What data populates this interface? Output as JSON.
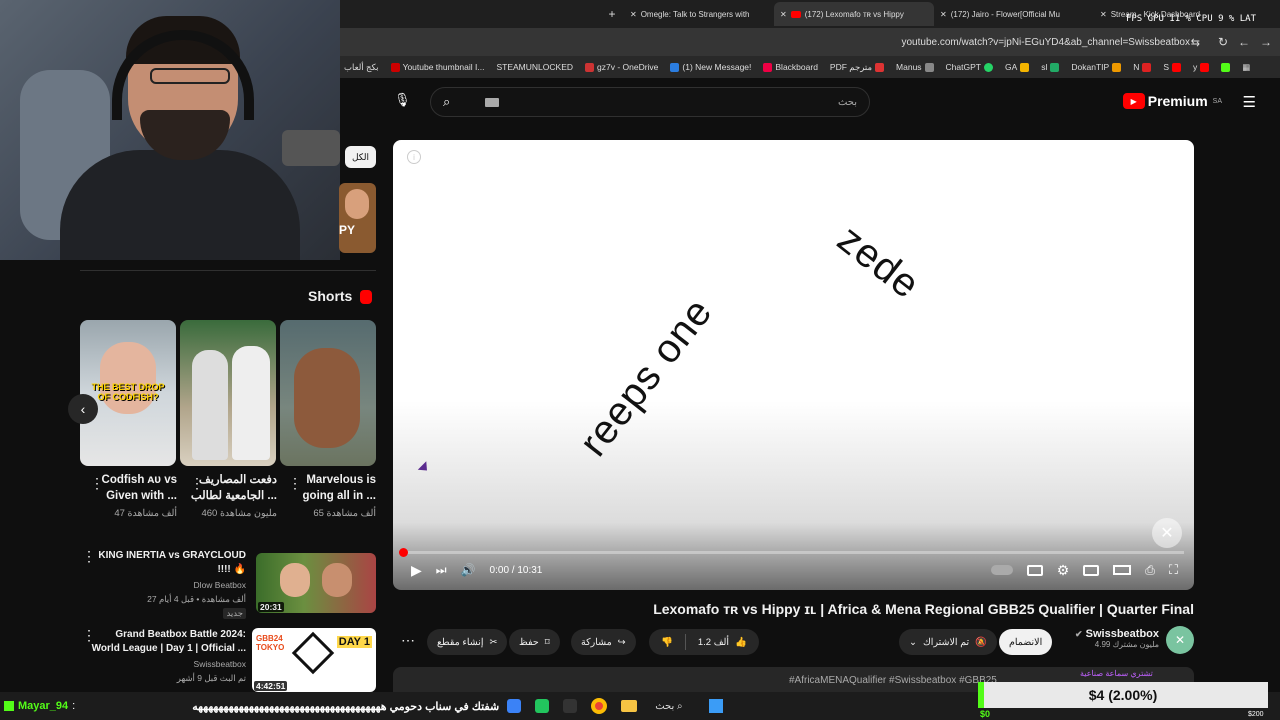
{
  "browser": {
    "tabs": [
      {
        "label": "Omegle: Talk to Strangers with"
      },
      {
        "label": "(172) Lexomafo ᴛʀ vs Hippy",
        "active": true
      },
      {
        "label": "(172) Jairo - Flower[Official Mu"
      },
      {
        "label": "Stream - Kick Dashboard"
      }
    ],
    "url": "youtube.com/watch?v=jpNi-EGuYD4&ab_channel=Swissbeatbox",
    "bookmarks": [
      "Youtube thumbnail I...",
      "STEAMUNLOCKED",
      "gz7v - OneDrive",
      "(1) New Message!",
      "Blackboard",
      "PDF مترجم",
      "Manus",
      "ChatGPT",
      "GA",
      "sl",
      "DokanTIP",
      "N",
      "S",
      "y"
    ],
    "bookmark_left": "بكج ألعاب"
  },
  "hud": {
    "fps": "FPS",
    "gpu": "GPU 11 % CPU 9 % LAT"
  },
  "youtube": {
    "logo": "Premium",
    "region": "SA",
    "search_placeholder": "بحث",
    "chip_all": "الكل",
    "video": {
      "overlay_text_1": "zede",
      "overlay_text_2": "reeps one",
      "time": "0:00 / 10:31",
      "progress_fraction": 0.0,
      "title": "Lexomafo ᴛʀ vs Hippy ɪʟ | Africa & Mena Regional GBB25 Qualifier | Quarter Final"
    },
    "channel": {
      "name": "Swissbeatbox",
      "subs": "4.99 مليون مشترك",
      "join": "الانضمام",
      "subscribed": "تم الاشتراك"
    },
    "actions": {
      "likes": "1.2 ألف",
      "share": "مشاركة",
      "save": "حفظ",
      "clip": "إنشاء مقطع"
    },
    "description": "#AfricaMENAQualifier #Swissbeatbox #GBB25",
    "shorts_label": "Shorts",
    "shorts": [
      {
        "title_1": "Codfish ᴀᴜ vs",
        "title_2": "Given with ...",
        "views": "47 ألف مشاهدة",
        "thumb_text": "THE BEST DROP OF CODFISH?"
      },
      {
        "title_1": "دفعت المصاريف",
        "title_2": "الجامعية لطالب ...",
        "views": "460 مليون مشاهدة"
      },
      {
        "title_1": "Marvelous is",
        "title_2": "going all in ...",
        "views": "65 ألف مشاهدة"
      }
    ],
    "recommended": [
      {
        "title_1": "KING INERTIA vs GRAYCLOUD",
        "title_2": "!!!! 🔥",
        "channel": "Dlow Beatbox",
        "meta": "27 ألف مشاهدة • قبل 4 أيام",
        "badge": "جديد",
        "duration": "20:31"
      },
      {
        "title_1": "Grand Beatbox Battle 2024:",
        "title_2": "World League | Day 1 | Official ...",
        "channel": "Swissbeatbox",
        "meta": "تم البث قبل 9 أشهر",
        "duration": "4:42:51",
        "thumb_text_1": "GBB24 TOKYO",
        "thumb_text_2": "DAY 1"
      }
    ]
  },
  "overlay": {
    "chat_user": "Mayar_94",
    "chat_message": "شفتك في سناب دحومي هههههههههههههههههههههههههههههههههههههه",
    "donation": "$4 (2.00%)",
    "donation_fraction": 0.02,
    "goal_min": "$0",
    "goal_max": "$200",
    "notice": "تشتري سماعة صناعية"
  },
  "taskbar": {
    "search": "بحث"
  },
  "colors": {
    "yt_red": "#ff0000",
    "bg": "#0f0f0f",
    "kick_green": "#53fc18"
  }
}
